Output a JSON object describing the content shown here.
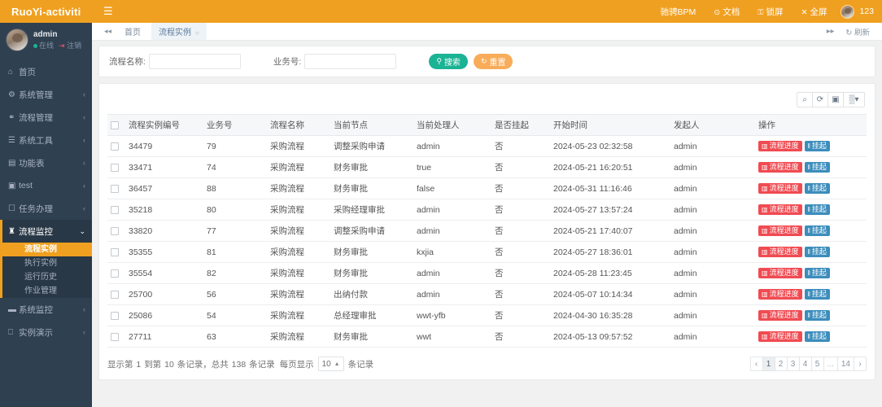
{
  "brand": {
    "title": "RuoYi-activiti"
  },
  "sidebar": {
    "profile": {
      "name": "admin",
      "status": "在线",
      "logout": "注销"
    },
    "items": [
      {
        "label": "首页",
        "icon": "home-icon",
        "glyph": "⌂",
        "expandable": false
      },
      {
        "label": "系统管理",
        "icon": "gear-icon",
        "glyph": "⚙",
        "expandable": true
      },
      {
        "label": "流程管理",
        "icon": "flow-icon",
        "glyph": "⚭",
        "expandable": true
      },
      {
        "label": "系统工具",
        "icon": "tools-icon",
        "glyph": "☰",
        "expandable": true
      },
      {
        "label": "功能表",
        "icon": "table-icon",
        "glyph": "▤",
        "expandable": true
      },
      {
        "label": "test",
        "icon": "save-icon",
        "glyph": "▣",
        "expandable": true
      },
      {
        "label": "任务办理",
        "icon": "bell-icon",
        "glyph": "☐",
        "expandable": true
      },
      {
        "label": "流程监控",
        "icon": "monitor-icon",
        "glyph": "♜",
        "expandable": true,
        "open": true
      },
      {
        "label": "系统监控",
        "icon": "server-icon",
        "glyph": "▬",
        "expandable": true
      },
      {
        "label": "实例演示",
        "icon": "display-icon",
        "glyph": "⎕",
        "expandable": true
      }
    ],
    "submenu": [
      {
        "label": "流程实例",
        "selected": true
      },
      {
        "label": "执行实例",
        "selected": false
      },
      {
        "label": "运行历史",
        "selected": false
      },
      {
        "label": "作业管理",
        "selected": false
      }
    ]
  },
  "topnav": {
    "hamburger_icon": "hamburger-icon",
    "items": [
      {
        "label": "驰骋BPM",
        "icon": "none",
        "glyph": ""
      },
      {
        "label": "文档",
        "icon": "question-circle-icon",
        "glyph": "⊙"
      },
      {
        "label": "锁屏",
        "icon": "lock-icon",
        "glyph": "⚿"
      },
      {
        "label": "全屏",
        "icon": "expand-icon",
        "glyph": "✕"
      }
    ],
    "username": "123"
  },
  "tabstrip": {
    "prev_icon": "chevron-double-left-icon",
    "next_icon": "chevron-double-right-icon",
    "tabs": [
      {
        "label": "首页",
        "active": false,
        "closable": false
      },
      {
        "label": "流程实例",
        "active": true,
        "closable": true
      }
    ],
    "refresh_label": "刷新",
    "refresh_icon": "refresh-icon"
  },
  "search": {
    "process_name_label": "流程名称:",
    "process_name_value": "",
    "process_name_placeholder": "",
    "business_key_label": "业务号:",
    "business_key_value": "",
    "business_key_placeholder": "",
    "search_button": "搜索",
    "search_icon": "search-icon",
    "reset_button": "重置",
    "reset_icon": "refresh-icon"
  },
  "toolbar": {
    "buttons": [
      {
        "name": "search-toggle-button",
        "icon": "search-icon",
        "glyph": "⌕"
      },
      {
        "name": "refresh-button",
        "icon": "refresh-icon",
        "glyph": "⟳"
      },
      {
        "name": "fullscreen-button",
        "icon": "window-icon",
        "glyph": "▣"
      },
      {
        "name": "columns-button",
        "icon": "grid-icon",
        "glyph": "▒"
      }
    ]
  },
  "table": {
    "columns": [
      "流程实例编号",
      "业务号",
      "流程名称",
      "当前节点",
      "当前处理人",
      "是否挂起",
      "开始时间",
      "发起人",
      "操作"
    ],
    "action_labels": {
      "progress": "流程进度",
      "progress_icon": "chart-icon",
      "suspend": "挂起",
      "suspend_icon": "pause-icon"
    },
    "rows": [
      {
        "id": "34479",
        "biz": "79",
        "name": "采购流程",
        "node": "调整采购申请",
        "assignee": "admin",
        "suspended": "否",
        "start": "2024-05-23 02:32:58",
        "starter": "admin"
      },
      {
        "id": "33471",
        "biz": "74",
        "name": "采购流程",
        "node": "财务审批",
        "assignee": "true",
        "suspended": "否",
        "start": "2024-05-21 16:20:51",
        "starter": "admin"
      },
      {
        "id": "36457",
        "biz": "88",
        "name": "采购流程",
        "node": "财务审批",
        "assignee": "false",
        "suspended": "否",
        "start": "2024-05-31 11:16:46",
        "starter": "admin"
      },
      {
        "id": "35218",
        "biz": "80",
        "name": "采购流程",
        "node": "采购经理审批",
        "assignee": "admin",
        "suspended": "否",
        "start": "2024-05-27 13:57:24",
        "starter": "admin"
      },
      {
        "id": "33820",
        "biz": "77",
        "name": "采购流程",
        "node": "调整采购申请",
        "assignee": "admin",
        "suspended": "否",
        "start": "2024-05-21 17:40:07",
        "starter": "admin"
      },
      {
        "id": "35355",
        "biz": "81",
        "name": "采购流程",
        "node": "财务审批",
        "assignee": "kxjia",
        "suspended": "否",
        "start": "2024-05-27 18:36:01",
        "starter": "admin"
      },
      {
        "id": "35554",
        "biz": "82",
        "name": "采购流程",
        "node": "财务审批",
        "assignee": "admin",
        "suspended": "否",
        "start": "2024-05-28 11:23:45",
        "starter": "admin"
      },
      {
        "id": "25700",
        "biz": "56",
        "name": "采购流程",
        "node": "出纳付款",
        "assignee": "admin",
        "suspended": "否",
        "start": "2024-05-07 10:14:34",
        "starter": "admin"
      },
      {
        "id": "25086",
        "biz": "54",
        "name": "采购流程",
        "node": "总经理审批",
        "assignee": "wwt-yfb",
        "suspended": "否",
        "start": "2024-04-30 16:35:28",
        "starter": "admin"
      },
      {
        "id": "27711",
        "biz": "63",
        "name": "采购流程",
        "node": "财务审批",
        "assignee": "wwt",
        "suspended": "否",
        "start": "2024-05-13 09:57:52",
        "starter": "admin"
      }
    ]
  },
  "pager": {
    "info_prefix": "显示第",
    "from": "1",
    "info_mid": "到第",
    "to": "10",
    "info_records": "条记录，总共",
    "total": "138",
    "info_records2": "条记录",
    "per_page_label": "每页显示",
    "page_size": "10",
    "per_page_suffix": "条记录",
    "pages": [
      "1",
      "2",
      "3",
      "4",
      "5",
      "...",
      "14"
    ],
    "prev_glyph": "‹",
    "next_glyph": "›",
    "active_page": "1"
  },
  "colors": {
    "brand_orange": "#f0a020",
    "sidebar_dark": "#2f4050",
    "search_green": "#1ab394",
    "reset_orange": "#f8ac59",
    "tag_red": "#f04b52",
    "tag_blue": "#3c8dbc"
  }
}
